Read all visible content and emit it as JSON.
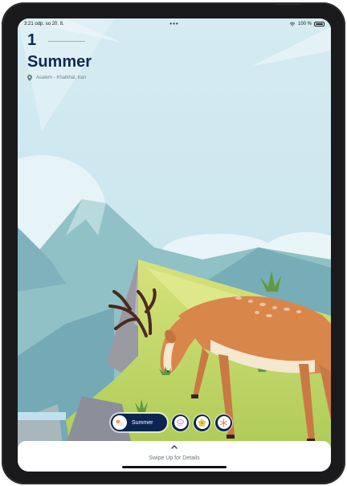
{
  "status_bar": {
    "time_date": "3:21 odp.  so 20. 8.",
    "dots": "•••",
    "battery": "100 %"
  },
  "header": {
    "number": "1",
    "season": "Summer",
    "location": "Asalem - Khalkhal, Iran"
  },
  "selector": {
    "active_label": "Summer",
    "items": [
      {
        "name": "summer",
        "icon": "sun-cloud-icon"
      },
      {
        "name": "autumn",
        "icon": "cloud-rain-icon"
      },
      {
        "name": "spring",
        "icon": "flower-icon"
      },
      {
        "name": "winter",
        "icon": "snowflake-icon"
      }
    ]
  },
  "sheet": {
    "hint": "Swipe Up for Details"
  },
  "colors": {
    "navy": "#0c2550",
    "title": "#0e2a4f",
    "sky": "#d8ecf1"
  }
}
